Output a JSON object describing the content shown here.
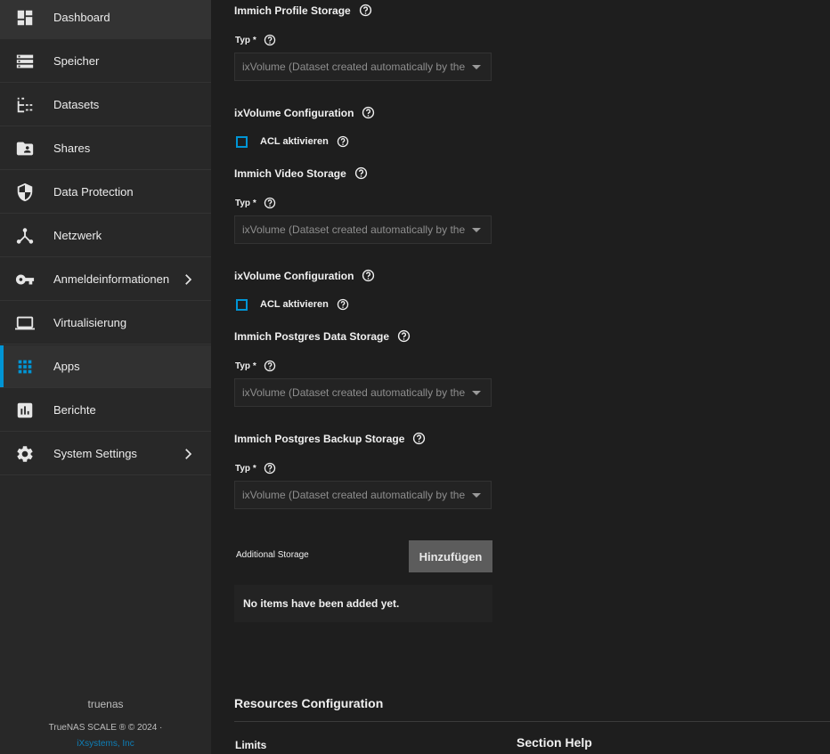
{
  "sidebar": {
    "items": [
      {
        "label": "Dashboard",
        "icon": "dashboard-icon"
      },
      {
        "label": "Speicher",
        "icon": "storage-icon"
      },
      {
        "label": "Datasets",
        "icon": "datasets-icon"
      },
      {
        "label": "Shares",
        "icon": "shares-folder-icon"
      },
      {
        "label": "Data Protection",
        "icon": "shield-icon"
      },
      {
        "label": "Netzwerk",
        "icon": "network-icon"
      },
      {
        "label": "Anmeldeinformationen",
        "icon": "key-icon",
        "has_submenu": true
      },
      {
        "label": "Virtualisierung",
        "icon": "laptop-icon"
      },
      {
        "label": "Apps",
        "icon": "apps-grid-icon",
        "active": true
      },
      {
        "label": "Berichte",
        "icon": "reports-chart-icon"
      },
      {
        "label": "System Settings",
        "icon": "gear-icon",
        "has_submenu": true
      }
    ],
    "footer": {
      "hostname": "truenas",
      "copyright": "TrueNAS SCALE ® © 2024 ·",
      "company": "iXsystems, Inc"
    }
  },
  "main": {
    "profile_storage": {
      "title": "Immich Profile Storage",
      "type_label": "Typ *",
      "type_value": "ixVolume (Dataset created automatically by the system)"
    },
    "ixvolume_config_1": {
      "title": "ixVolume Configuration",
      "acl_label": "ACL aktivieren"
    },
    "video_storage": {
      "title": "Immich Video Storage",
      "type_label": "Typ *",
      "type_value": "ixVolume (Dataset created automatically by the system)"
    },
    "ixvolume_config_2": {
      "title": "ixVolume Configuration",
      "acl_label": "ACL aktivieren"
    },
    "postgres_data_storage": {
      "title": "Immich Postgres Data Storage",
      "type_label": "Typ *",
      "type_value": "ixVolume (Dataset created automatically by the system)"
    },
    "postgres_backup_storage": {
      "title": "Immich Postgres Backup Storage",
      "type_label": "Typ *",
      "type_value": "ixVolume (Dataset created automatically by the system)"
    },
    "additional_storage": {
      "label": "Additional Storage",
      "add_button": "Hinzufügen",
      "empty_text": "No items have been added yet."
    },
    "resources": {
      "title": "Resources Configuration",
      "limits_label": "Limits"
    },
    "section_help": "Section Help"
  },
  "colors": {
    "accent": "#0095d5",
    "background": "#1e1e1e",
    "sidebar": "#282828"
  }
}
